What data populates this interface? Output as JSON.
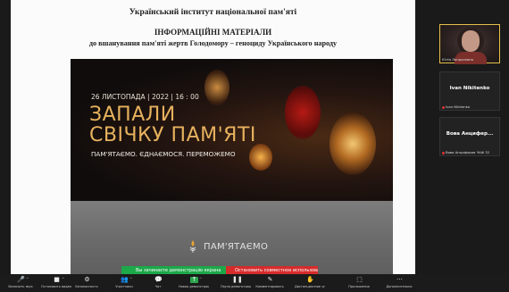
{
  "document": {
    "organization": "Український інститут національної пам'яті",
    "title": "ІНФОРМАЦІЙНІ МАТЕРІАЛИ",
    "subtitle": "до вшанування пам'яті жертв Голодомору – геноциду Українського народу"
  },
  "poster": {
    "date": "26 ЛИСТОПАДА | 2022 | 16 : 00",
    "headline_line1": "ЗАПАЛИ",
    "headline_line2": "СВІЧКУ ПАМ'ЯТІ",
    "tagline": "ПАМ'ЯТАЄМО. ЄДНАЄМОСЯ. ПЕРЕМОЖЕМО",
    "logo_text": "ПАМ'ЯТАЄМО"
  },
  "share_status": {
    "green_text": "Вы зачинаєте демонстрацію екрана",
    "red_text": "Остановить совместное использование"
  },
  "participants": [
    {
      "label": "Юлія Лапросевна"
    },
    {
      "center_name": "Ivan Nikitenko",
      "label": "Ivan Nikitenko"
    },
    {
      "center_name": "Вова Анцифер...",
      "label": "Вова Анцифоров ЧАФ 32"
    }
  ],
  "toolbar": {
    "items": [
      {
        "icon": "mic-icon",
        "glyph": "🎤",
        "label": "Включить звук"
      },
      {
        "icon": "video-icon",
        "glyph": "■",
        "label": "Остановить видео"
      },
      {
        "icon": "security-icon",
        "glyph": "⚙",
        "label": "Безопасность"
      },
      {
        "icon": "participants-icon",
        "glyph": "👥",
        "label": "Участники"
      },
      {
        "icon": "chat-icon",
        "glyph": "💬",
        "label": "Чат"
      },
      {
        "icon": "share-screen-icon",
        "glyph": "↑",
        "label": "Новая демонстрация"
      },
      {
        "icon": "pause-icon",
        "glyph": "❚❚",
        "label": "Пауза демонстрации"
      },
      {
        "icon": "annotate-icon",
        "glyph": "✎",
        "label": "Комментировать"
      },
      {
        "icon": "remote-control-icon",
        "glyph": "✋",
        "label": "Дистанционное управление"
      },
      {
        "icon": "apps-icon",
        "glyph": "⬚",
        "label": "Приложения"
      },
      {
        "icon": "more-icon",
        "glyph": "···",
        "label": "Дополнительно"
      }
    ]
  },
  "colors": {
    "poster_accent": "#e7b25e",
    "share_green": "#1da84a",
    "share_red": "#d62c2c",
    "active_speaker_border": "#e6c04a"
  }
}
